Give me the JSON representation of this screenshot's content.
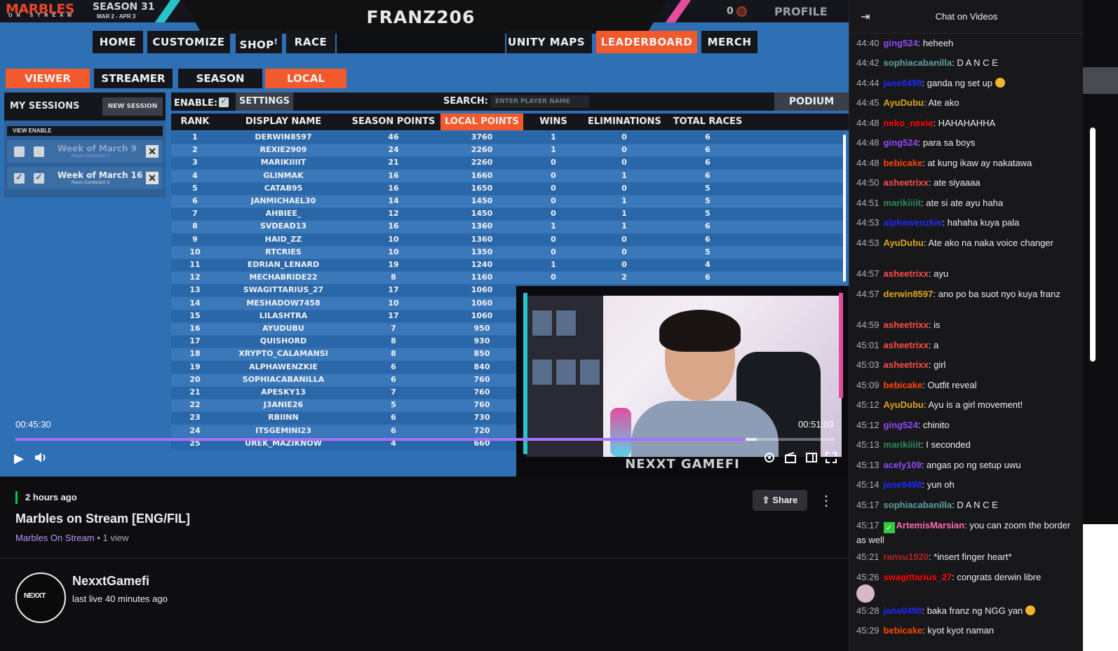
{
  "game": {
    "brand": "MARBLES",
    "brand_sub": "ON STREAM",
    "season": "SEASON 31",
    "season_dates": "MAR 2 - APR 3",
    "title": "FRANZ206",
    "coins": "0",
    "profile": "PROFILE",
    "nav": [
      "HOME",
      "CUSTOMIZE",
      "SHOP",
      "RACE",
      "UNITY MAPS",
      "LEADERBOARD",
      "MERCH"
    ],
    "shop_badge": "!",
    "tabs": [
      "VIEWER",
      "STREAMER",
      "SEASON",
      "LOCAL"
    ],
    "sessions": {
      "title": "MY SESSIONS",
      "new_session": "NEW SESSION",
      "view_enable": "VIEW  ENABLE",
      "items": [
        {
          "name": "Week of March 9",
          "sub": "Races Conducted: 0",
          "checked": false
        },
        {
          "name": "Week of March 16",
          "sub": "Races Conducted: 6",
          "checked": true
        }
      ]
    },
    "leaderboard": {
      "enable": "ENABLE:",
      "settings": "SETTINGS",
      "search": "SEARCH:",
      "search_placeholder": "ENTER PLAYER NAME",
      "podium": "PODIUM",
      "columns": [
        "RANK",
        "DISPLAY NAME",
        "SEASON POINTS",
        "LOCAL POINTS",
        "WINS",
        "ELIMINATIONS",
        "TOTAL RACES"
      ],
      "rows": [
        [
          "1",
          "DERWIN8597",
          "46",
          "3760",
          "1",
          "0",
          "6"
        ],
        [
          "2",
          "REXIE2909",
          "24",
          "2260",
          "1",
          "0",
          "6"
        ],
        [
          "3",
          "MARIKIIIIT",
          "21",
          "2260",
          "0",
          "0",
          "6"
        ],
        [
          "4",
          "GLINMAK",
          "16",
          "1660",
          "0",
          "1",
          "6"
        ],
        [
          "5",
          "CATAB95",
          "16",
          "1650",
          "0",
          "0",
          "5"
        ],
        [
          "6",
          "JANMICHAEL30",
          "14",
          "1450",
          "0",
          "1",
          "5"
        ],
        [
          "7",
          "AHBIEE_",
          "12",
          "1450",
          "0",
          "1",
          "5"
        ],
        [
          "8",
          "SVDEAD13",
          "16",
          "1360",
          "1",
          "1",
          "6"
        ],
        [
          "9",
          "HAID_ZZ",
          "10",
          "1360",
          "0",
          "0",
          "6"
        ],
        [
          "10",
          "RTCRIES",
          "10",
          "1350",
          "0",
          "0",
          "5"
        ],
        [
          "11",
          "EDRIAN_LENARD",
          "19",
          "1240",
          "1",
          "0",
          "4"
        ],
        [
          "12",
          "MECHABRIDE22",
          "8",
          "1160",
          "0",
          "2",
          "6"
        ],
        [
          "13",
          "SWAGITTARIUS_27",
          "17",
          "1060",
          "",
          "",
          ""
        ],
        [
          "14",
          "MESHADOW7458",
          "10",
          "1060",
          "",
          "",
          ""
        ],
        [
          "15",
          "LILASHTRA",
          "17",
          "1060",
          "",
          "",
          ""
        ],
        [
          "16",
          "AYUDUBU",
          "7",
          "950",
          "",
          "",
          ""
        ],
        [
          "17",
          "QUISHORD",
          "8",
          "930",
          "",
          "",
          ""
        ],
        [
          "18",
          "XRYPTO_CALAMANSI",
          "8",
          "850",
          "",
          "",
          ""
        ],
        [
          "19",
          "ALPHAWENZKIE",
          "6",
          "840",
          "",
          "",
          ""
        ],
        [
          "20",
          "SOPHIACABANILLA",
          "6",
          "760",
          "",
          "",
          ""
        ],
        [
          "21",
          "APESKY13",
          "7",
          "760",
          "",
          "",
          ""
        ],
        [
          "22",
          "J3ANIE26",
          "5",
          "760",
          "",
          "",
          ""
        ],
        [
          "23",
          "RBIINN",
          "6",
          "730",
          "",
          "",
          ""
        ],
        [
          "24",
          "ITSGEMINI23",
          "6",
          "720",
          "",
          "",
          ""
        ],
        [
          "25",
          "UREK_MAZIKNOW",
          "4",
          "660",
          "",
          "",
          ""
        ]
      ]
    },
    "cam_label": "NEXXT GAMEFI"
  },
  "player": {
    "time_elapsed": "00:45:30",
    "time_total": "00:51:03",
    "progress_fraction": 0.891,
    "buffered_fraction": 0.905
  },
  "video_info": {
    "ago": "2 hours ago",
    "title": "Marbles on Stream [ENG/FIL]",
    "category": "Marbles On Stream",
    "views": " • 1 view",
    "share": "Share",
    "channel": "NexxtGamefi",
    "last_live": "last live 40 minutes ago",
    "avatar_text": "NEXXT"
  },
  "chat": {
    "title": "Chat on Videos",
    "messages": [
      {
        "ts": "44:40",
        "user": "ging524",
        "color": "#9147ff",
        "text": ": heheeh"
      },
      {
        "ts": "44:42",
        "user": "sophiacabanilla",
        "color": "#5f9ea0",
        "text": ": D A N C E"
      },
      {
        "ts": "44:44",
        "user": "jane0498",
        "color": "#1e29ff",
        "text": ": ganda ng set up",
        "emoji": true
      },
      {
        "ts": "44:45",
        "user": "AyuDubu",
        "color": "#daa520",
        "text": ": Ate ako"
      },
      {
        "ts": "44:48",
        "user": "neko_nexie",
        "color": "#ff0000",
        "text": ": HAHAHAHHA"
      },
      {
        "ts": "44:48",
        "user": "ging524",
        "color": "#9147ff",
        "text": ": para sa boys"
      },
      {
        "ts": "44:48",
        "user": "bebicake",
        "color": "#ff4500",
        "text": ": at kung ikaw ay nakatawa"
      },
      {
        "ts": "44:50",
        "user": "asheetrixx",
        "color": "#ff4b4b",
        "text": ": ate siyaaaa"
      },
      {
        "ts": "44:51",
        "user": "marikiiiit",
        "color": "#2e8b57",
        "text": ": ate si ate ayu haha"
      },
      {
        "ts": "44:53",
        "user": "alphawenzkie",
        "color": "#1e29ff",
        "text": ": hahaha kuya pala"
      },
      {
        "ts": "44:53",
        "user": "AyuDubu",
        "color": "#daa520",
        "text": ": Ate ako na naka voice changer"
      },
      {
        "ts": "44:57",
        "user": "asheetrixx",
        "color": "#ff4b4b",
        "text": ": ayu"
      },
      {
        "ts": "44:57",
        "user": "derwin8597",
        "color": "#daa520",
        "text": ": ano po ba suot nyo kuya franz"
      },
      {
        "ts": "44:59",
        "user": "asheetrixx",
        "color": "#ff4b4b",
        "text": ": is"
      },
      {
        "ts": "45:01",
        "user": "asheetrixx",
        "color": "#ff4b4b",
        "text": ": a"
      },
      {
        "ts": "45:03",
        "user": "asheetrixx",
        "color": "#ff4b4b",
        "text": ": girl"
      },
      {
        "ts": "45:09",
        "user": "bebicake",
        "color": "#ff4500",
        "text": ": Outfit reveal"
      },
      {
        "ts": "45:12",
        "user": "AyuDubu",
        "color": "#daa520",
        "text": ": Ayu is a girl movement!"
      },
      {
        "ts": "45:12",
        "user": "ging524",
        "color": "#9147ff",
        "text": ": chinito"
      },
      {
        "ts": "45:13",
        "user": "marikiiiit",
        "color": "#2e8b57",
        "text": ": I seconded"
      },
      {
        "ts": "45:13",
        "user": "acely109",
        "color": "#9147ff",
        "text": ": angas po ng setup uwu"
      },
      {
        "ts": "45:14",
        "user": "jane0498",
        "color": "#1e29ff",
        "text": ": yun oh"
      },
      {
        "ts": "45:17",
        "user": "sophiacabanilla",
        "color": "#5f9ea0",
        "text": ": D A N C E"
      },
      {
        "ts": "45:17",
        "user": "ArtemisMarsian",
        "color": "#ff69b4",
        "text": ": you can zoom the border as well",
        "badge": true
      },
      {
        "ts": "45:21",
        "user": "ransu1920",
        "color": "#b22222",
        "text": ": *insert finger heart*"
      },
      {
        "ts": "45:26",
        "user": "swagittarius_27",
        "color": "#ff0000",
        "text": ": congrats derwin libre",
        "sticker": true
      },
      {
        "ts": "45:28",
        "user": "jane0498",
        "color": "#1e29ff",
        "text": ": baka franz ng NGG yan",
        "emoji": true
      },
      {
        "ts": "45:29",
        "user": "bebicake",
        "color": "#ff4500",
        "text": ": kyot kyot naman"
      }
    ]
  }
}
